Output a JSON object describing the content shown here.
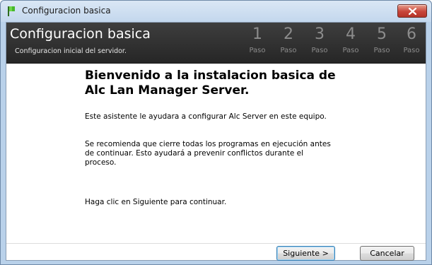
{
  "window": {
    "title": "Configuracion basica",
    "close_icon": "close-icon",
    "app_icon": "green-flag-icon"
  },
  "header": {
    "title": "Configuracion basica",
    "subtitle": "Configuracion inicial del servidor.",
    "steps": [
      {
        "number": "1",
        "label": "Paso"
      },
      {
        "number": "2",
        "label": "Paso"
      },
      {
        "number": "3",
        "label": "Paso"
      },
      {
        "number": "4",
        "label": "Paso"
      },
      {
        "number": "5",
        "label": "Paso"
      },
      {
        "number": "6",
        "label": "Paso"
      }
    ]
  },
  "content": {
    "heading_line1": "Bienvenido a la instalacion basica de",
    "heading_line2": "Alc Lan Manager Server.",
    "paragraph1": "Este asistente le ayudara a configurar Alc Server en este equipo.",
    "paragraph2_line1": "Se recomienda que cierre todas los programas en ejecución antes",
    "paragraph2_line2": "de continuar.  Esto ayudará a prevenir conflictos durante el",
    "paragraph2_line3": "proceso.",
    "paragraph3": "Haga clic en Siguiente para continuar."
  },
  "buttons": {
    "next_label": "Siguiente >",
    "cancel_label": "Cancelar"
  },
  "colors": {
    "header_bg": "#2e2e2e",
    "step_inactive": "#8c8c8c",
    "close_red": "#c7453a",
    "focus_border": "#3c7fb1"
  }
}
